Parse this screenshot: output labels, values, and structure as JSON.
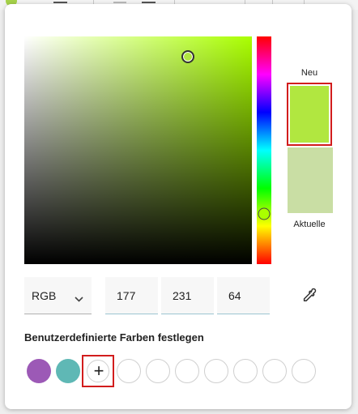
{
  "color_picker": {
    "hue_deg": 80,
    "saturation": 0.72,
    "value": 0.91,
    "new_color": "#b1e740",
    "current_color": "#c9dea4",
    "accent_highlight": "#d21d1d"
  },
  "labels": {
    "new": "Neu",
    "current": "Aktuelle"
  },
  "mode": {
    "selected": "RGB",
    "dropdown_icon": "chevron-down-icon"
  },
  "channels": {
    "r": "177",
    "g": "231",
    "b": "64"
  },
  "eyedropper_icon": "eyedropper-icon",
  "custom_colors": {
    "title": "Benutzerdefinierte Farben festlegen",
    "swatches": [
      "#9c59b6",
      "#5fb8b5"
    ],
    "add_label": "+",
    "empty_count": 7
  }
}
